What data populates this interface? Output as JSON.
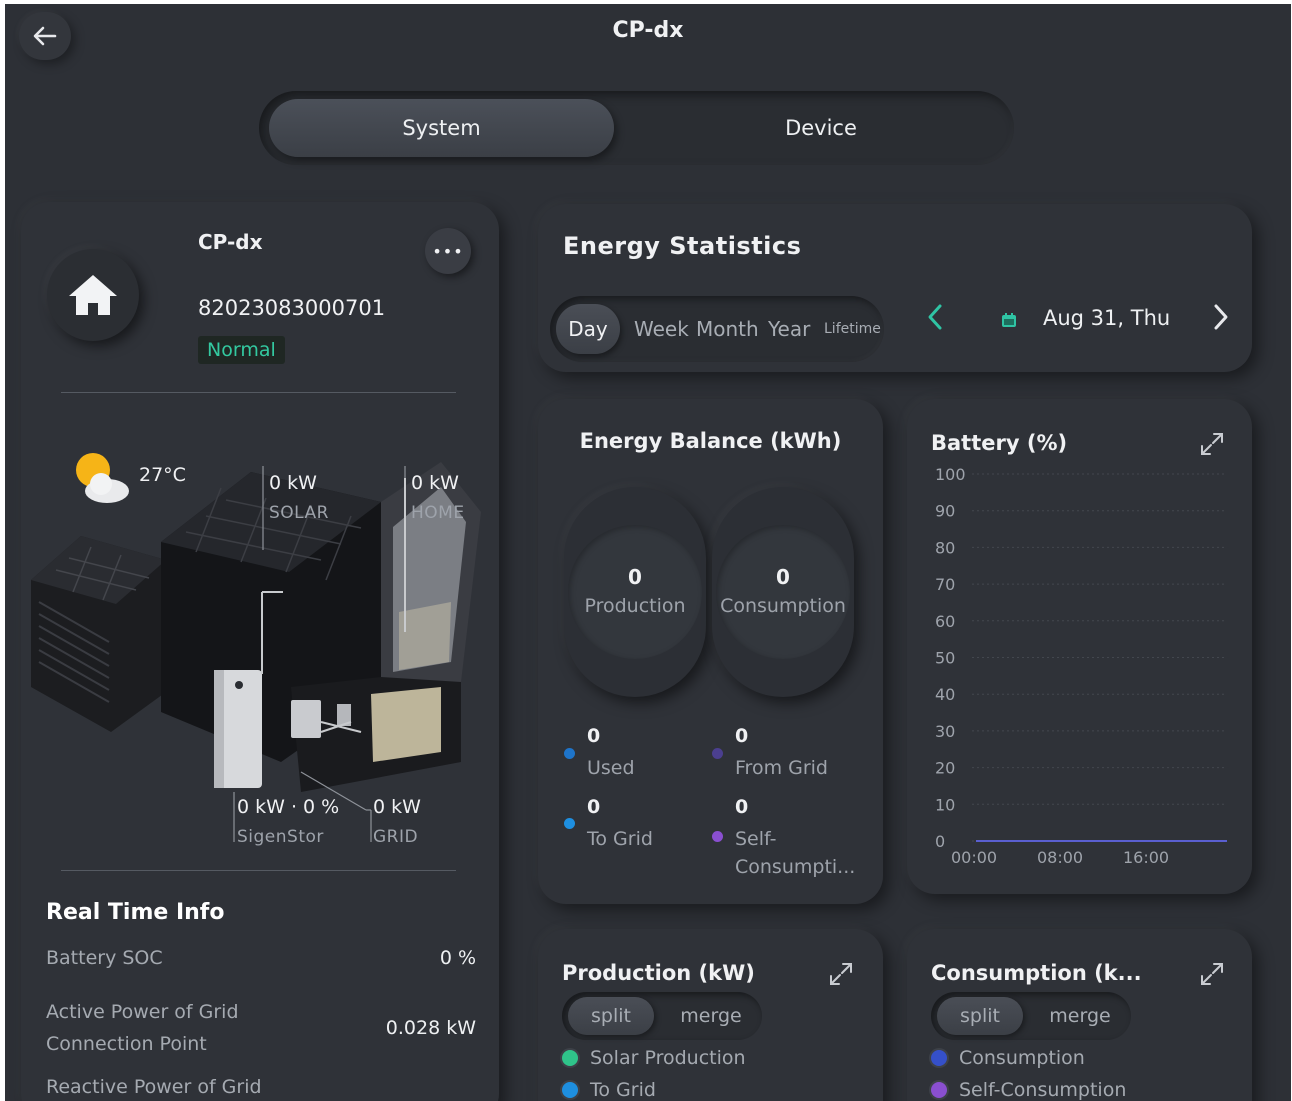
{
  "header": {
    "title": "CP-dx"
  },
  "tabs": [
    {
      "label": "System",
      "active": true
    },
    {
      "label": "Device",
      "active": false
    }
  ],
  "device": {
    "name": "CP-dx",
    "serial": "82023083000701",
    "status": "Normal",
    "status_color": "#33c9a0",
    "weather": {
      "icon": "partly-cloudy-icon",
      "temperature": "27°C"
    }
  },
  "flow": {
    "solar": {
      "value": "0 kW",
      "label": "SOLAR"
    },
    "home": {
      "value": "0 kW",
      "label": "HOME"
    },
    "battery": {
      "value": "0 kW · 0 %",
      "label": "SigenStor"
    },
    "grid": {
      "value": "0 kW",
      "label": "GRID"
    }
  },
  "realtime": {
    "title": "Real Time Info",
    "rows": [
      {
        "label": "Battery SOC",
        "value": "0 %"
      },
      {
        "label": "Active Power of Grid Connection Point",
        "value": "0.028 kW"
      },
      {
        "label": "Reactive Power of Grid",
        "value": ""
      }
    ]
  },
  "energy_stats": {
    "title": "Energy Statistics",
    "periods": [
      "Day",
      "Week",
      "Month",
      "Year",
      "Lifetime"
    ],
    "active_period": "Day",
    "date": "Aug 31, Thu",
    "accent": "#2fc4a4"
  },
  "energy_balance": {
    "title": "Energy Balance (kWh)",
    "production": {
      "value": "0",
      "label": "Production"
    },
    "consumption": {
      "value": "0",
      "label": "Consumption"
    },
    "legend": [
      {
        "value": "0",
        "label": "Used",
        "color": "#1e74c9"
      },
      {
        "value": "0",
        "label": "From Grid",
        "color": "#4b3f8f"
      },
      {
        "value": "0",
        "label": "To Grid",
        "color": "#1e8fe0"
      },
      {
        "value": "0",
        "label": "Self-\nConsumpti...",
        "color": "#8a4fd0"
      }
    ]
  },
  "battery_chart": {
    "title": "Battery (%)"
  },
  "chart_data": {
    "type": "line",
    "title": "Battery (%)",
    "xlabel": "",
    "ylabel": "",
    "x": [
      "00:00",
      "08:00",
      "16:00"
    ],
    "yticks": [
      0,
      10,
      20,
      30,
      40,
      50,
      60,
      70,
      80,
      90,
      100
    ],
    "ylim": [
      0,
      100
    ],
    "series": [
      {
        "values": [
          0,
          0,
          0
        ],
        "color": "#5a5fd0"
      }
    ],
    "grid": true
  },
  "production": {
    "title": "Production (kW)",
    "modes": [
      "split",
      "merge"
    ],
    "legend": [
      {
        "label": "Solar Production",
        "color": "#2fc48a"
      },
      {
        "label": "To Grid",
        "color": "#1e8fe0"
      }
    ]
  },
  "consumption": {
    "title": "Consumption (k...",
    "modes": [
      "split",
      "merge"
    ],
    "legend": [
      {
        "label": "Consumption",
        "color": "#3550c9"
      },
      {
        "label": "Self-Consumption",
        "color": "#8a4fd0"
      }
    ]
  }
}
